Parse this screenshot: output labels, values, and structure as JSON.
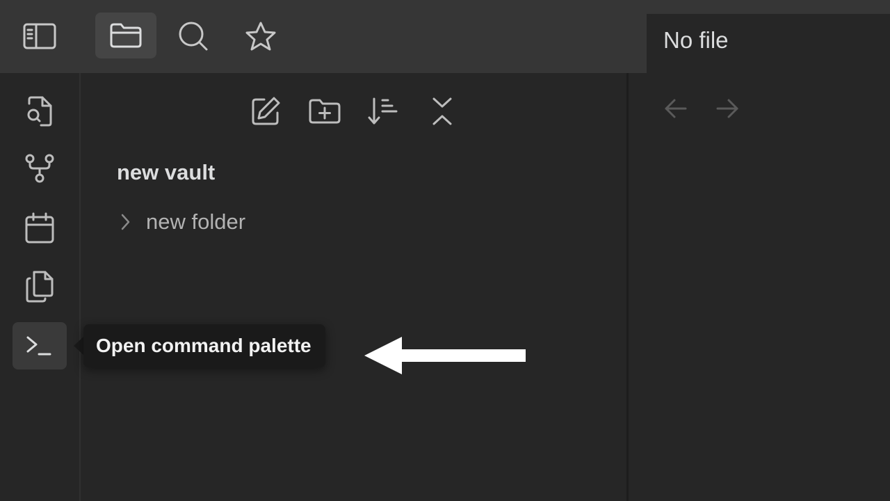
{
  "header": {
    "icons": [
      "sidebar-toggle-icon",
      "folder-icon",
      "search-icon",
      "star-icon"
    ]
  },
  "ribbon": {
    "icons": [
      "file-search-icon",
      "graph-icon",
      "calendar-icon",
      "copy-icon",
      "terminal-icon"
    ],
    "active": "terminal-icon"
  },
  "file_explorer": {
    "toolbar_icons": [
      "new-note-icon",
      "new-folder-icon",
      "sort-icon",
      "collapse-icon"
    ],
    "vault_name": "new vault",
    "items": [
      {
        "label": "new folder",
        "type": "folder",
        "expanded": false
      }
    ]
  },
  "editor": {
    "tab_title": "No file"
  },
  "tooltip": {
    "text": "Open command palette"
  },
  "colors": {
    "background": "#262626",
    "header": "#363636",
    "text": "#dcddde",
    "muted_text": "#b3b3b3",
    "tooltip_bg": "#1a1a1a",
    "annotation_arrow": "#ffffff"
  }
}
